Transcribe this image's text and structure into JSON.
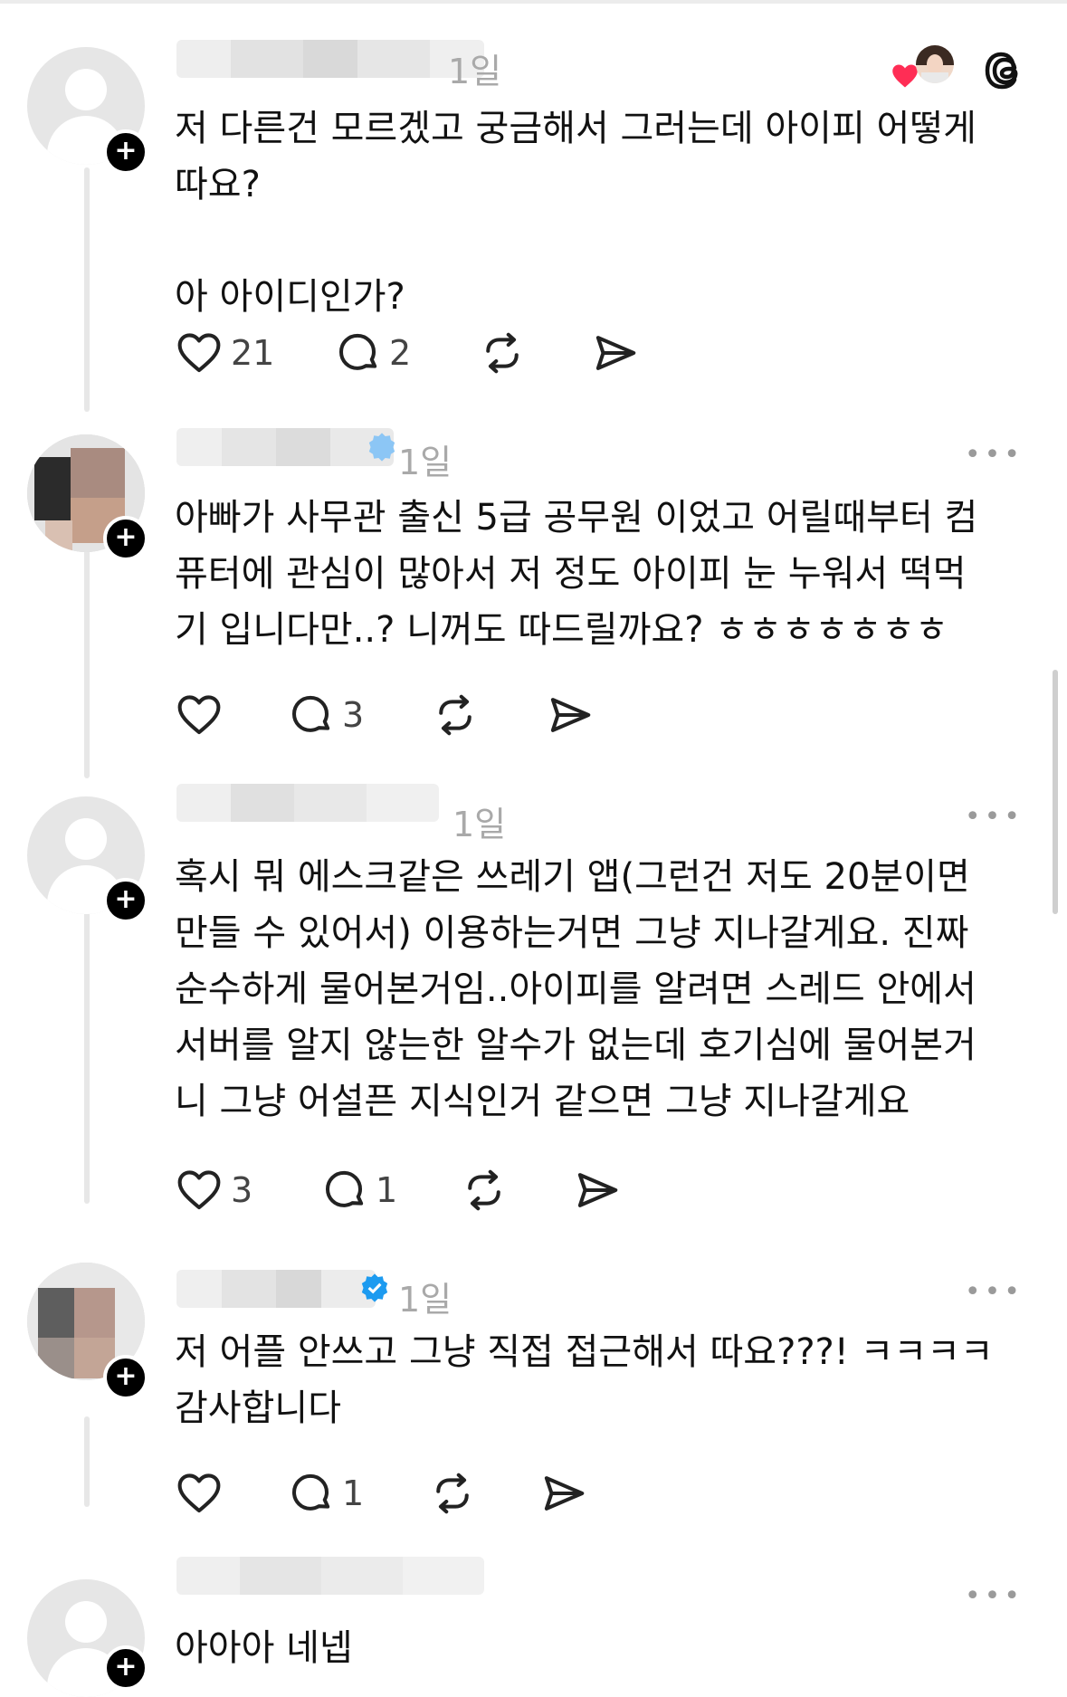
{
  "posts": [
    {
      "timestamp": "1일",
      "content": "저 다른건 모르겠고 궁금해서 그러는데 아이피 어떻게\n따요?\n\n아 아이디인가?",
      "likes": "21",
      "replies": "2"
    },
    {
      "timestamp": "1일",
      "content": "아빠가 사무관 출신 5급 공무원 이었고 어릴때부터 컴\n퓨터에 관심이 많아서 저 정도 아이피 눈 누워서 떡먹\n기 입니다만..? 니꺼도 따드릴까요? ㅎㅎㅎㅎㅎㅎㅎ",
      "likes": "",
      "replies": "3"
    },
    {
      "timestamp": "1일",
      "content": "혹시 뭐 에스크같은 쓰레기 앱(그런건 저도 20분이면\n만들 수 있어서) 이용하는거면 그냥 지나갈게요. 진짜\n순수하게 물어본거임..아이피를 알려면 스레드 안에서\n서버를 알지 않는한 알수가 없는데 호기심에 물어본거\n니 그냥 어설픈 지식인거 같으면 그냥 지나갈게요",
      "likes": "3",
      "replies": "1"
    },
    {
      "timestamp": "1일",
      "content": "저 어플 안쓰고 그냥 직접 접근해서 따요???! ㅋㅋㅋㅋ\n감사합니다",
      "likes": "",
      "replies": "1"
    },
    {
      "timestamp": "",
      "content": "아아아 네넵",
      "likes": "",
      "replies": ""
    }
  ],
  "more_label": "•••",
  "plus_label": "+",
  "colors": {
    "text": "#111111",
    "muted": "#a9a9a9",
    "verified": "#1d9bf0",
    "heart": "#ff2d55"
  },
  "icons": [
    "heart-icon",
    "comment-icon",
    "repost-icon",
    "share-icon",
    "threads-logo-icon",
    "more-icon",
    "verified-badge-icon"
  ]
}
